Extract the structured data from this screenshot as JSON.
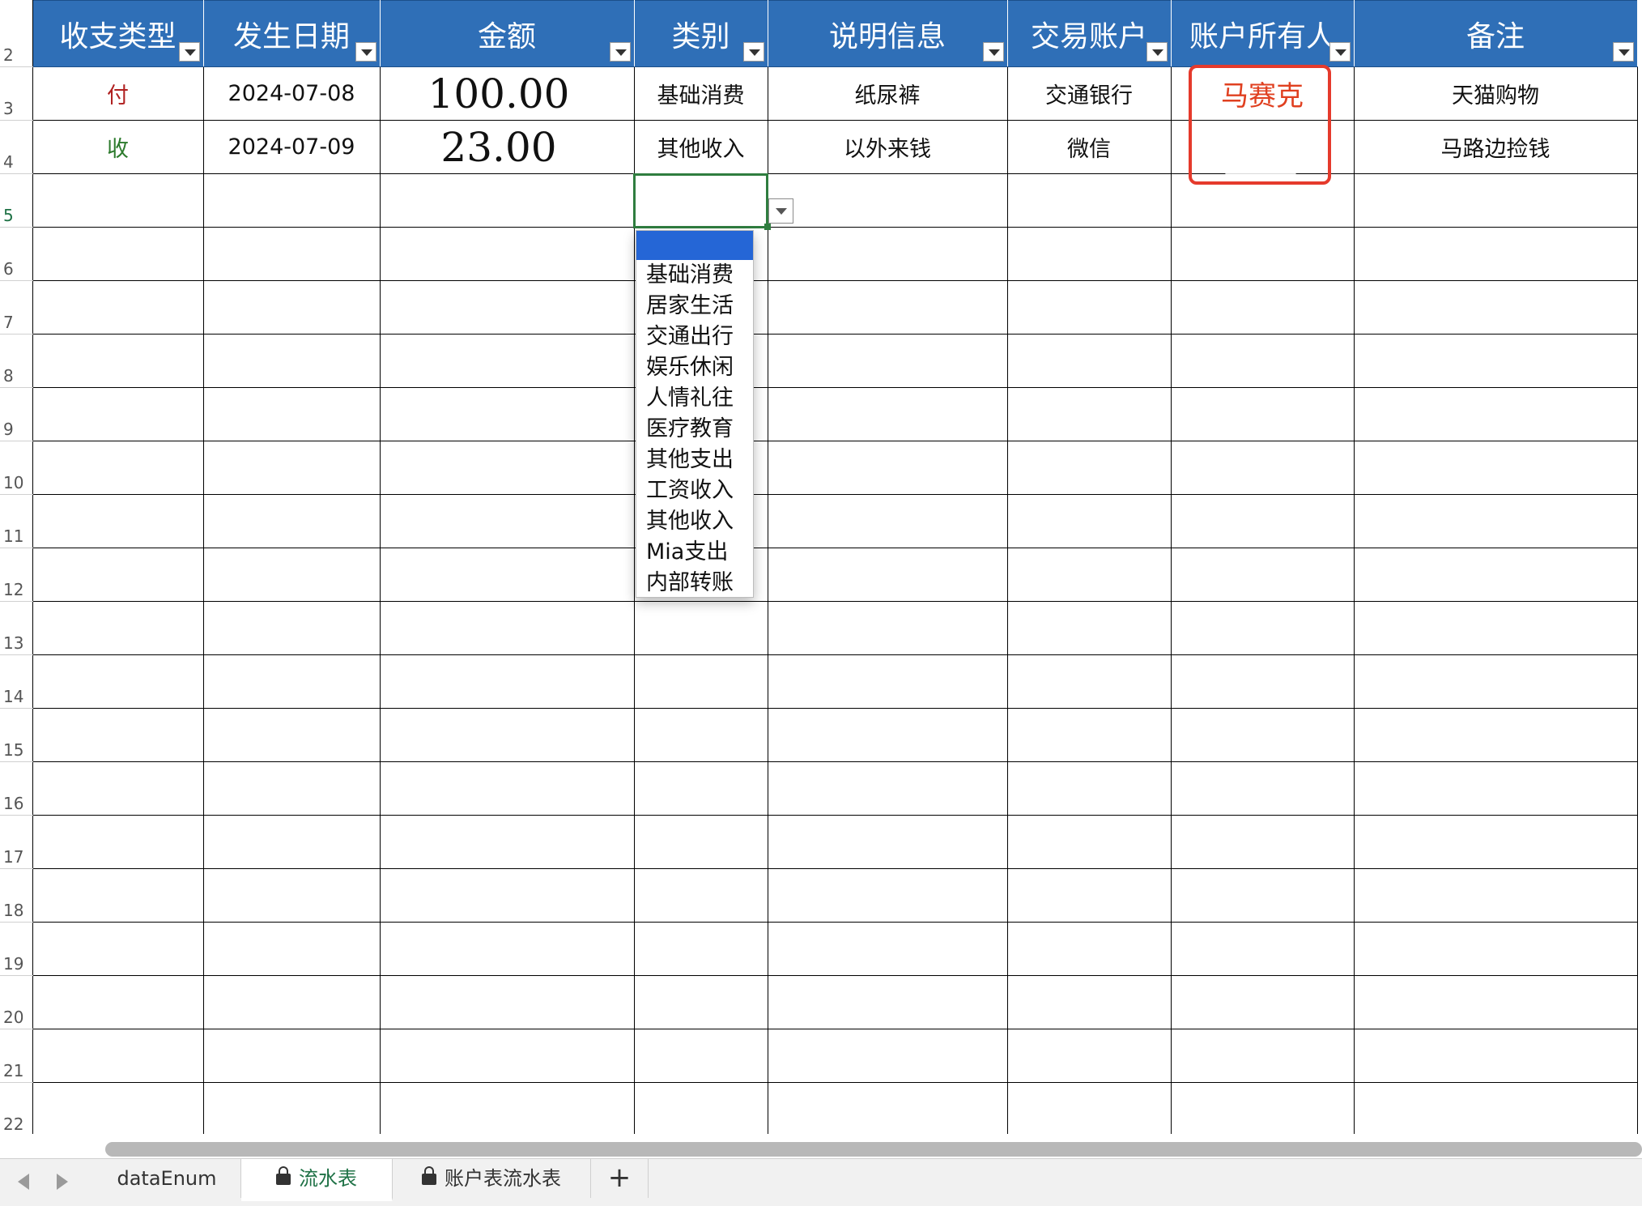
{
  "columns": [
    "收支类型",
    "发生日期",
    "金额",
    "类别",
    "说明信息",
    "交易账户",
    "账户所有人",
    "备注"
  ],
  "row_numbers": [
    "2",
    "3",
    "4",
    "5",
    "6",
    "7",
    "8",
    "9",
    "10",
    "11",
    "12",
    "13",
    "14",
    "15",
    "16",
    "17",
    "18",
    "19",
    "20",
    "21",
    "22"
  ],
  "rows": [
    {
      "type": "付",
      "date": "2024-07-08",
      "amount": "100.00",
      "category": "基础消费",
      "desc": "纸尿裤",
      "account": "交通银行",
      "owner": "马赛克",
      "note": "天猫购物"
    },
    {
      "type": "收",
      "date": "2024-07-09",
      "amount": "23.00",
      "category": "其他收入",
      "desc": "以外来钱",
      "account": "微信",
      "owner": "",
      "note": "马路边捡钱"
    }
  ],
  "dropdown": {
    "items": [
      "基础消费",
      "居家生活",
      "交通出行",
      "娱乐休闲",
      "人情礼往",
      "医疗教育",
      "其他支出",
      "工资收入",
      "其他收入",
      "Mia支出",
      "内部转账"
    ]
  },
  "tabs": [
    "dataEnum",
    "流水表",
    "账户表流水表"
  ],
  "active_tab": "流水表",
  "add_tab_label": "+",
  "colors": {
    "header_bg": "#2f6fb7",
    "pay": "#b02020",
    "recv": "#2c7a2c",
    "annotation": "#e53a2c",
    "selection": "#2f7d3f"
  }
}
